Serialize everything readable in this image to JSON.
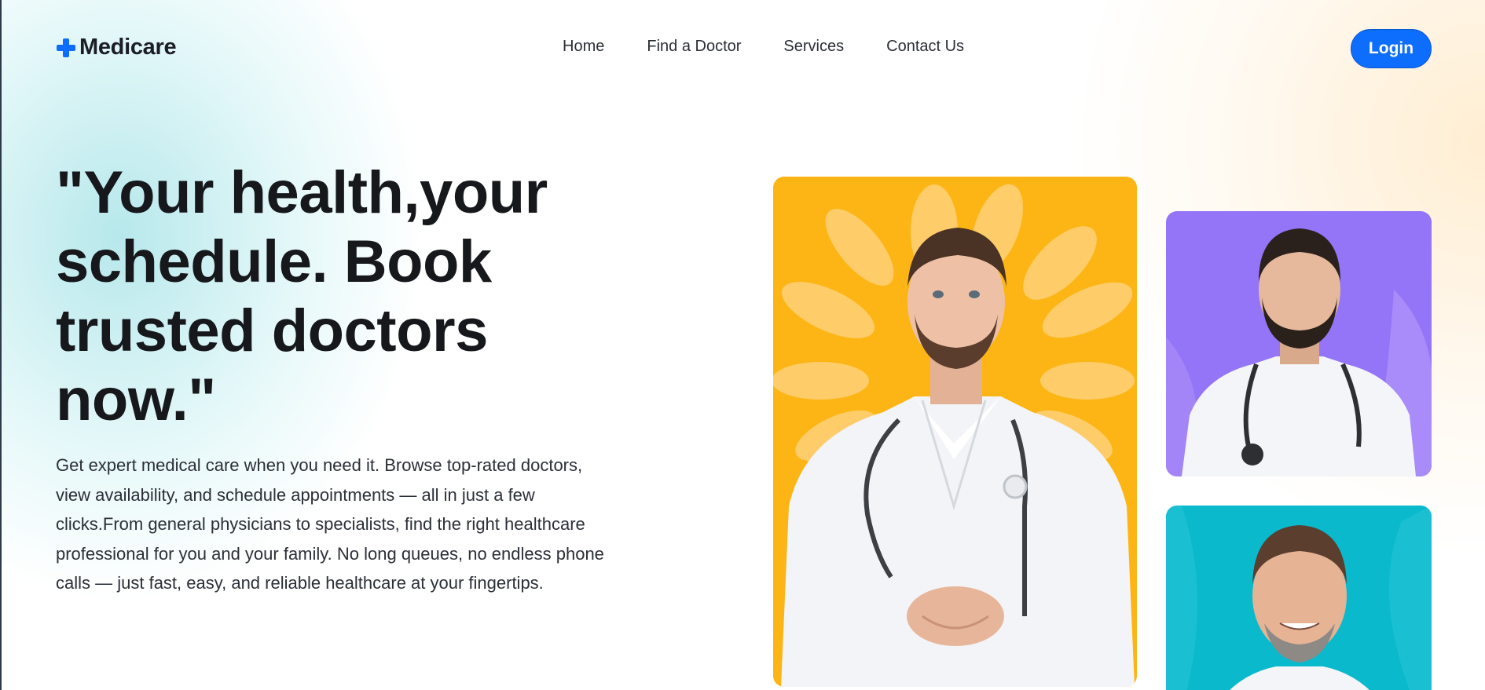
{
  "brand": {
    "name": "Medicare",
    "accent": "#0d6efd"
  },
  "nav": {
    "items": [
      "Home",
      "Find a Doctor",
      "Services",
      "Contact Us"
    ]
  },
  "login": {
    "label": "Login"
  },
  "hero": {
    "title": "\"Your health,your schedule. Book trusted doctors now.\"",
    "text": "Get expert medical care when you need it. Browse top-rated doctors, view availability, and schedule appointments — all in just a few clicks.From general physicians to specialists, find the right healthcare professional for you and your family. No long queues, no endless phone calls — just fast, easy, and reliable healthcare at your fingertips."
  },
  "cards": {
    "main": {
      "color": "#fcb514"
    },
    "purple": {
      "color": "#9474f7"
    },
    "teal": {
      "color": "#0ab9cc"
    }
  }
}
